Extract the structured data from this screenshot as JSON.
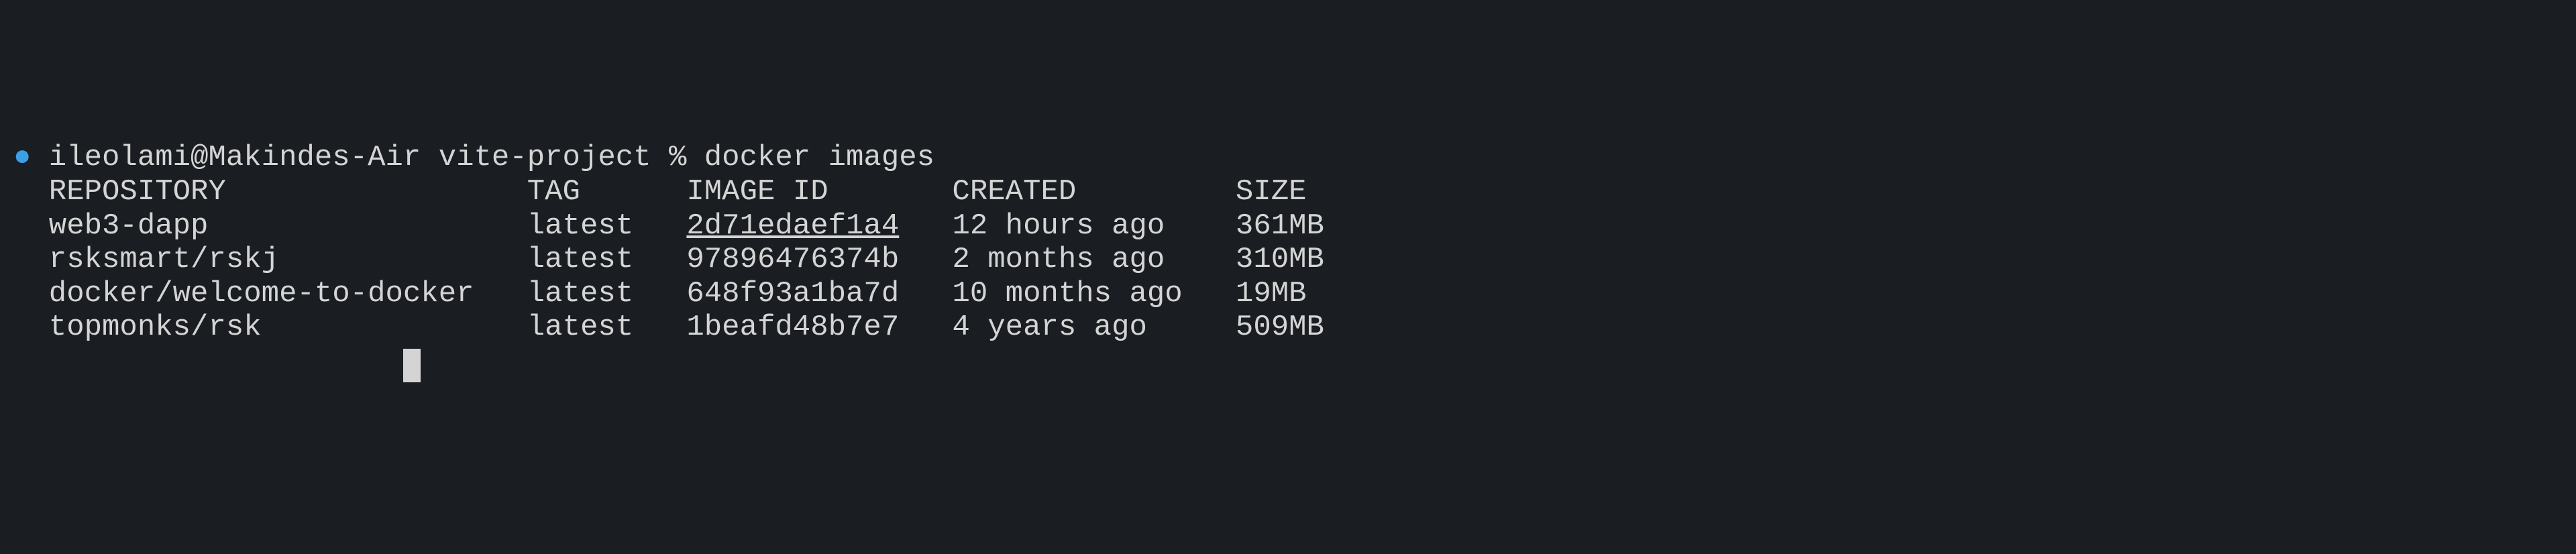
{
  "prompt": {
    "bullet_glyph": "●",
    "user": "ileolami",
    "host": "Makindes-Air",
    "cwd": "vite-project",
    "symbol": "%",
    "command": "docker images"
  },
  "table": {
    "headers": {
      "repository": "REPOSITORY",
      "tag": "TAG",
      "image_id": "IMAGE ID",
      "created": "CREATED",
      "size": "SIZE"
    },
    "rows": [
      {
        "repository": "web3-dapp",
        "tag": "latest",
        "image_id": "2d71edaef1a4",
        "created": "12 hours ago",
        "size": "361MB",
        "image_id_underlined": true
      },
      {
        "repository": "rsksmart/rskj",
        "tag": "latest",
        "image_id": "97896476374b",
        "created": "2 months ago",
        "size": "310MB",
        "image_id_underlined": false
      },
      {
        "repository": "docker/welcome-to-docker",
        "tag": "latest",
        "image_id": "648f93a1ba7d",
        "created": "10 months ago",
        "size": "19MB",
        "image_id_underlined": false
      },
      {
        "repository": "topmonks/rsk",
        "tag": "latest",
        "image_id": "1beafd48b7e7",
        "created": "4 years ago",
        "size": "509MB",
        "image_id_underlined": false
      }
    ]
  },
  "column_widths": {
    "repo": 27,
    "tag": 9,
    "image_id": 15,
    "created": 16
  },
  "indent": "  "
}
